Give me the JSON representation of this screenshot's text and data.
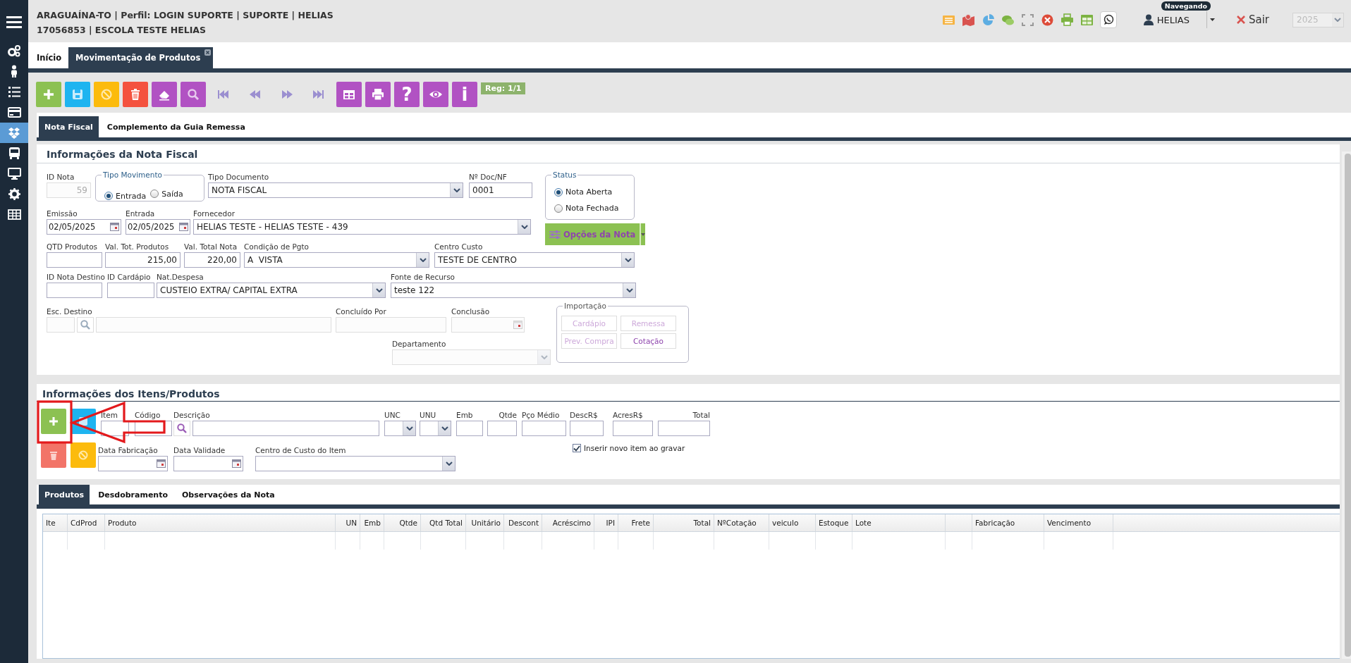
{
  "header": {
    "lines": [
      "ARAGUAÍNA-TO | Perfil: LOGIN SUPORTE | SUPORTE | HELIAS",
      "17056853 | ESCOLA TESTE HELIAS"
    ],
    "user": {
      "name": "HELIAS",
      "status": "Navegando"
    },
    "logout": "Sair",
    "year": "2025"
  },
  "sidebar": {
    "items": [
      {
        "selected": false
      },
      {
        "selected": false
      },
      {
        "selected": false
      },
      {
        "selected": false
      },
      {
        "selected": true
      },
      {
        "selected": false
      },
      {
        "selected": false
      },
      {
        "selected": false
      },
      {
        "selected": false
      }
    ]
  },
  "page_tabs": [
    {
      "label": "Início",
      "selected": false,
      "closable": false
    },
    {
      "label": "Movimentação de Produtos",
      "selected": true,
      "closable": true
    }
  ],
  "toolbar": {
    "buttons": [
      {
        "kind": "add"
      },
      {
        "kind": "save"
      },
      {
        "kind": "cancel"
      },
      {
        "kind": "delete"
      },
      {
        "kind": "clear"
      },
      {
        "kind": "search"
      },
      {
        "kind": "first"
      },
      {
        "kind": "prev"
      },
      {
        "kind": "next"
      },
      {
        "kind": "last"
      },
      {
        "kind": "grid"
      },
      {
        "kind": "print"
      },
      {
        "kind": "help",
        "glyph": "?"
      },
      {
        "kind": "view"
      },
      {
        "kind": "info",
        "glyph": "i"
      }
    ],
    "record": "Reg: 1/1"
  },
  "invoice_tabs": [
    {
      "label": "Nota Fiscal",
      "selected": true
    },
    {
      "label": "Complemento da Guia Remessa",
      "selected": false
    }
  ],
  "nota_fiscal": {
    "title": "Informações da Nota Fiscal",
    "rows": [
      {
        "fields": [
          {
            "kind": "number",
            "label": "ID Nota",
            "value": "59",
            "disabled": true
          },
          {
            "kind": "radio-group",
            "label": "Tipo Movimento",
            "options": [
              {
                "label": "Entrada",
                "selected": true
              },
              {
                "label": "Saída",
                "selected": false
              }
            ]
          },
          {
            "kind": "select",
            "label": "Tipo Documento",
            "value": "NOTA FISCAL",
            "disabled": false
          },
          {
            "kind": "text",
            "label": "Nº Doc/NF",
            "value": "0001",
            "disabled": false
          }
        ]
      },
      {
        "fields": [
          {
            "kind": "date",
            "label": "Emissão",
            "value": "02/05/2025",
            "disabled": false
          },
          {
            "kind": "date",
            "label": "Entrada",
            "value": "02/05/2025",
            "disabled": false
          },
          {
            "kind": "select",
            "label": "Fornecedor",
            "value": "HELIAS TESTE - HELIAS TESTE - 439",
            "disabled": false
          }
        ]
      },
      {
        "fields": [
          {
            "kind": "text",
            "label": "QTD Produtos",
            "disabled": false
          },
          {
            "kind": "number",
            "label": "Val. Tot. Produtos",
            "value": "215,00",
            "disabled": false
          },
          {
            "kind": "number",
            "label": "Val. Total Nota",
            "value": "220,00",
            "disabled": false
          },
          {
            "kind": "select",
            "label": "Condição de Pgto",
            "value": "A  VISTA",
            "disabled": false
          },
          {
            "kind": "select",
            "label": "Centro Custo",
            "value": "TESTE DE CENTRO",
            "disabled": false
          }
        ]
      },
      {
        "fields": [
          {
            "kind": "text",
            "label": "ID Nota Destino",
            "disabled": false
          },
          {
            "kind": "text",
            "label": "ID Cardápio",
            "disabled": false
          },
          {
            "kind": "select",
            "label": "Nat.Despesa",
            "value": "CUSTEIO EXTRA/ CAPITAL EXTRA",
            "disabled": false
          },
          {
            "kind": "select",
            "label": "Fonte de Recurso",
            "value": "teste 122",
            "disabled": false
          }
        ]
      },
      {
        "fields": [
          {
            "kind": "lookup",
            "label": "Esc. Destino",
            "disabled": true
          },
          {
            "kind": "text",
            "label": "Concluído Por",
            "disabled": true
          },
          {
            "kind": "date",
            "label": "Conclusão",
            "disabled": true
          }
        ]
      },
      {
        "fields": [
          {
            "kind": "select",
            "label": "Departamento",
            "disabled": true
          }
        ]
      }
    ],
    "status": {
      "label": "Status",
      "options": [
        {
          "label": "Nota Aberta",
          "selected": true
        },
        {
          "label": "Nota Fechada",
          "selected": false
        }
      ]
    },
    "options_button": "Opções da Nota",
    "importacao": {
      "label": "Importação",
      "buttons": [
        {
          "label": "Cardápio",
          "disabled": true
        },
        {
          "label": "Remessa",
          "disabled": true
        },
        {
          "label": "Prev. Compra",
          "disabled": true
        },
        {
          "label": "Cotação",
          "disabled": false
        }
      ]
    }
  },
  "items": {
    "title": "Informações dos Itens/Produtos",
    "buttons": [
      {
        "kind": "add"
      },
      {
        "kind": "save"
      },
      {
        "kind": "delete"
      },
      {
        "kind": "cancel"
      }
    ],
    "rows": [
      {
        "fields": [
          {
            "kind": "text",
            "label": "Item",
            "disabled": false
          },
          {
            "kind": "text",
            "label": "Código",
            "disabled": false
          },
          {
            "kind": "search-text",
            "label": "Descrição",
            "disabled": false
          },
          {
            "kind": "select",
            "label": "UNC",
            "disabled": false
          },
          {
            "kind": "select",
            "label": "UNU",
            "disabled": false
          },
          {
            "kind": "text",
            "label": "Emb",
            "disabled": false
          },
          {
            "kind": "text",
            "label": "Qtde",
            "disabled": false
          },
          {
            "kind": "text",
            "label": "Pço Médio",
            "disabled": false
          },
          {
            "kind": "text",
            "label": "DescR$",
            "disabled": false
          },
          {
            "kind": "text",
            "label": "AcresR$",
            "disabled": false
          },
          {
            "kind": "text",
            "label": "Total",
            "disabled": false
          }
        ]
      },
      {
        "fields": [
          {
            "kind": "date",
            "label": "Data Fabricação",
            "disabled": false
          },
          {
            "kind": "date",
            "label": "Data Validade",
            "disabled": false
          },
          {
            "kind": "select",
            "label": "Centro de Custo do Item",
            "disabled": false
          }
        ]
      }
    ],
    "insert_new": {
      "label": "Inserir novo item ao gravar",
      "checked": true
    }
  },
  "bottom_tabs": [
    {
      "label": "Produtos",
      "selected": true
    },
    {
      "label": "Desdobramento",
      "selected": false
    },
    {
      "label": "Observações da Nota",
      "selected": false
    }
  ],
  "table": {
    "columns": [
      "Ite",
      "CdProd",
      "Produto",
      "UN",
      "Emb",
      "Qtde",
      "Qtd Total",
      "Unitário",
      "Descont",
      "Acréscimo",
      "IPI",
      "Frete",
      "Total",
      "NºCotação",
      "veiculo",
      "Estoque",
      "Lote",
      "",
      "Fabricação",
      "Vencimento"
    ]
  }
}
